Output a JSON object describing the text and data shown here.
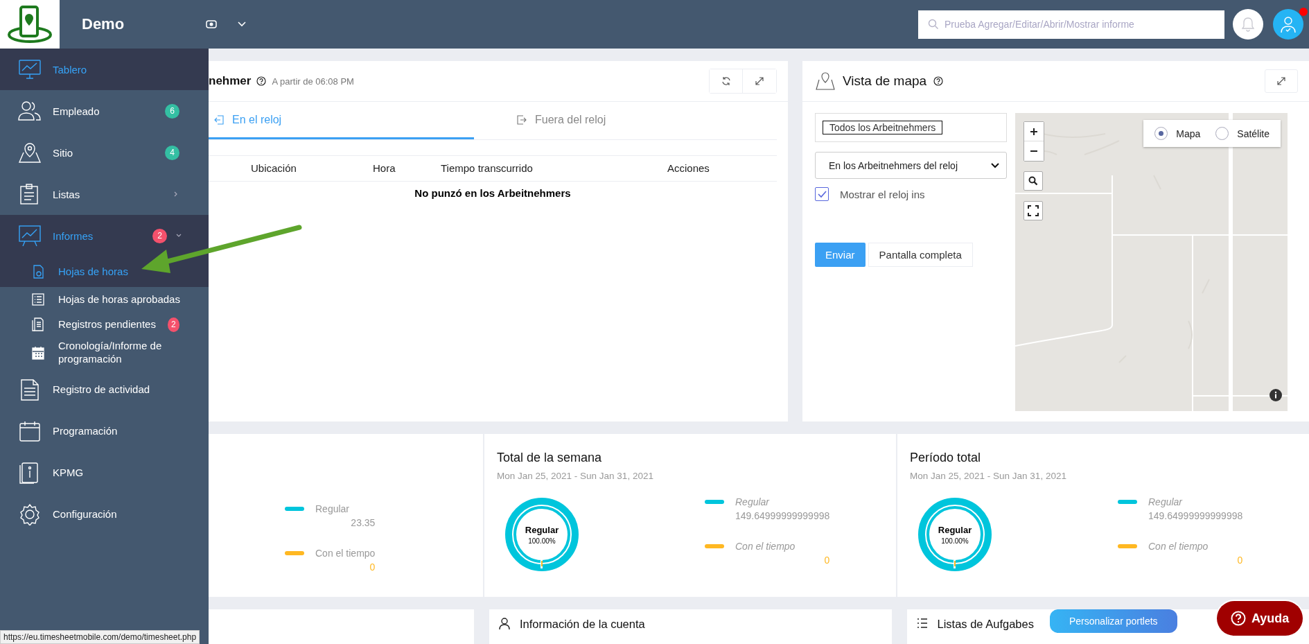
{
  "topbar": {
    "company": "Demo",
    "search": {
      "placeholder": "Prueba Agregar/Editar/Abrir/Mostrar informe"
    },
    "notification_dot": true
  },
  "sidebar": {
    "items": [
      {
        "label": "Tablero",
        "kind": "link",
        "selected": true
      },
      {
        "label": "Empleado",
        "kind": "link",
        "selected": false,
        "badge": "6",
        "color": "#34bfa3"
      },
      {
        "label": "Sitio",
        "kind": "link",
        "selected": false,
        "badge": "4",
        "color": "#34bfa3"
      },
      {
        "label": "Listas",
        "kind": "group",
        "selected": false,
        "expanded": false
      },
      {
        "label": "Informes",
        "kind": "group",
        "selected": true,
        "expanded": true,
        "badge": "2",
        "color": "#f4516c",
        "children": [
          {
            "label": "Hojas de horas",
            "selected": true
          },
          {
            "label": "Hojas de horas aprobadas",
            "selected": false
          },
          {
            "label": "Registros pendientes",
            "selected": false,
            "badge": "2",
            "color": "#f4516c"
          },
          {
            "label": "Cronología/Informe de programación",
            "selected": false
          }
        ]
      },
      {
        "label": "Registro de actividad",
        "kind": "link",
        "selected": false
      },
      {
        "label": "Programación",
        "kind": "link",
        "selected": false
      },
      {
        "label": "KPMG",
        "kind": "link",
        "selected": false
      },
      {
        "label": "Configuración",
        "kind": "link",
        "selected": false
      }
    ]
  },
  "clock_card": {
    "title": "nehmer",
    "subtitle": "A partir de 06:08 PM",
    "tabs": [
      {
        "label": "En el reloj",
        "selected": true
      },
      {
        "label": "Fuera del reloj",
        "selected": false
      }
    ],
    "columns": [
      "Ubicación",
      "Hora",
      "Tiempo transcurrido",
      "Acciones"
    ],
    "empty_message": "No punzó en los Arbeitnehmers"
  },
  "map_card": {
    "title": "Vista de mapa",
    "employee_filter": "Todos los Arbeitnehmers",
    "status_select": "En los Arbeitnehmers del reloj",
    "show_clock_ins": {
      "label": "Mostrar el reloj ins",
      "checked": true
    },
    "buttons": [
      "Enviar",
      "Pantalla completa"
    ],
    "map_types": [
      {
        "label": "Mapa",
        "selected": true
      },
      {
        "label": "Satélite",
        "selected": false
      }
    ]
  },
  "stats": [
    {
      "italic": false,
      "legend": [
        {
          "label": "Regular",
          "value": "23.35",
          "color": "#00c5dc"
        },
        {
          "label": "Con el tiempo",
          "value": "0",
          "color": "#ffb822"
        }
      ]
    },
    {
      "title": "Total de la semana",
      "date": "Mon Jan 25, 2021 - Sun Jan 31, 2021",
      "italic": true,
      "donut_label": "Regular",
      "donut_value": "100.00%",
      "legend": [
        {
          "label": "Regular",
          "value": "149.64999999999998",
          "color": "#00c5dc"
        },
        {
          "label": "Con el tiempo",
          "value": "0",
          "color": "#ffb822"
        }
      ]
    },
    {
      "title": "Período total",
      "date": "Mon Jan 25, 2021 - Sun Jan 31, 2021",
      "italic": true,
      "donut_label": "Regular",
      "donut_value": "100.00%",
      "legend": [
        {
          "label": "Regular",
          "value": "149.64999999999998",
          "color": "#00c5dc"
        },
        {
          "label": "Con el tiempo",
          "value": "0",
          "color": "#ffb822"
        }
      ]
    }
  ],
  "bottom_cards": [
    {
      "kind": "blank"
    },
    {
      "kind": "account",
      "title": "Información de la cuenta"
    },
    {
      "kind": "tasks",
      "title": "Listas de Aufgabes"
    }
  ],
  "customize_button": "Personalizar portlets",
  "help_button": "Ayuda",
  "status_url": "https://eu.timesheetmobile.com/demo/timesheet.php"
}
